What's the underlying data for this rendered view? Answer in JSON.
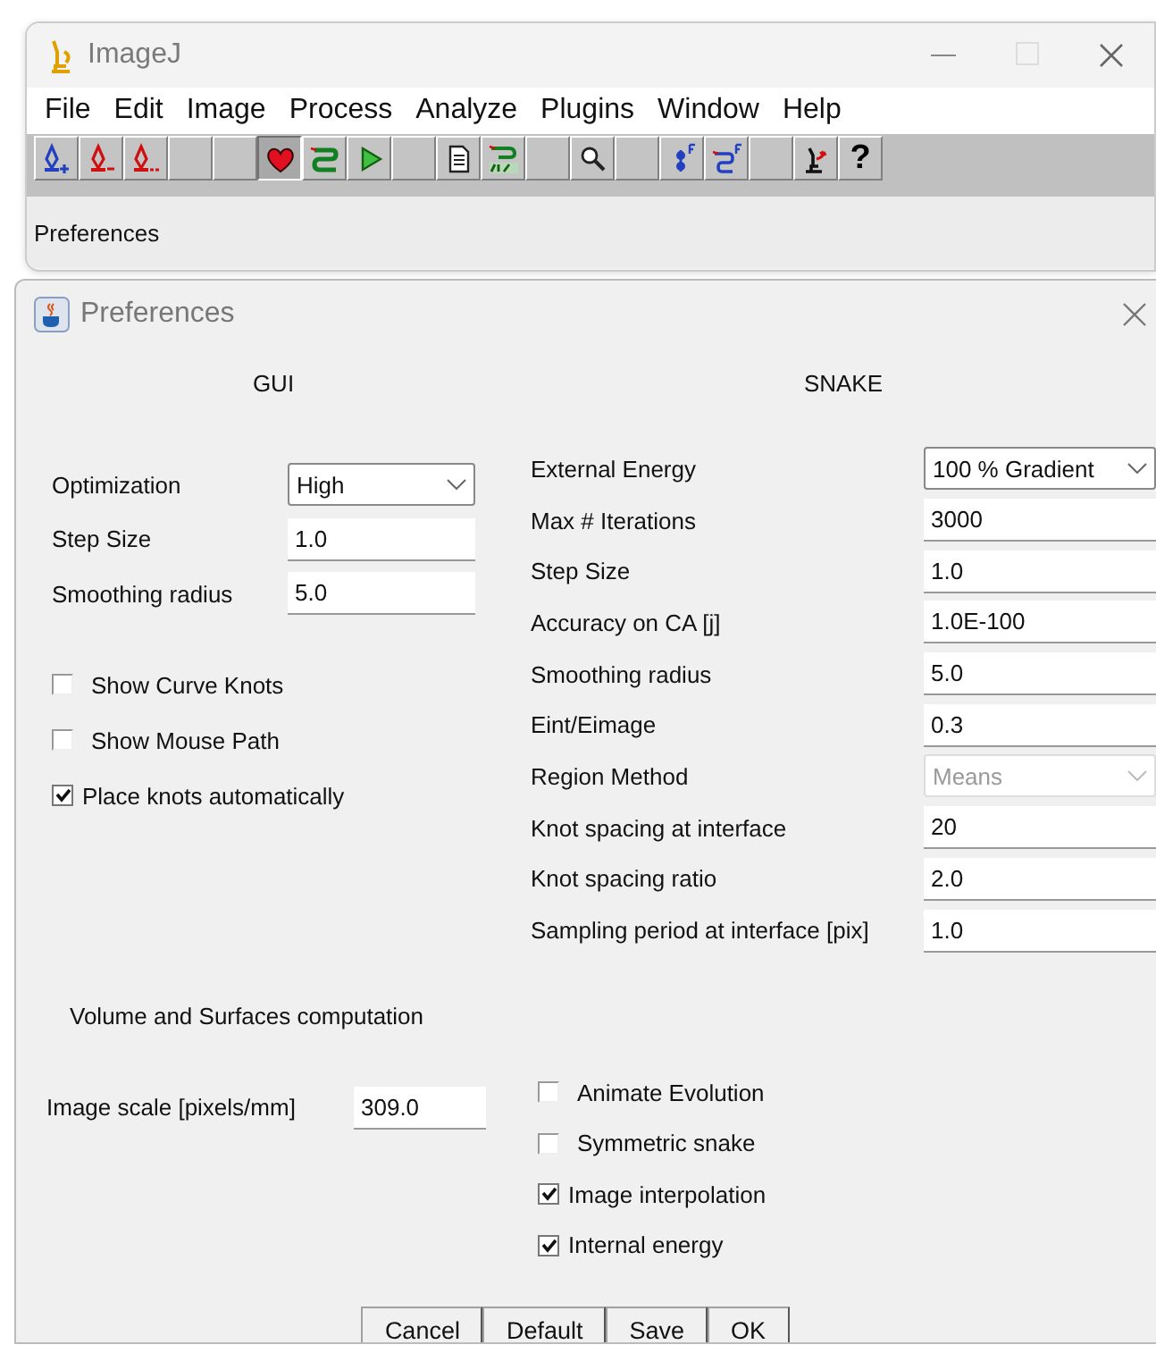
{
  "main_window": {
    "title": "ImageJ",
    "menu": [
      "File",
      "Edit",
      "Image",
      "Process",
      "Analyze",
      "Plugins",
      "Window",
      "Help"
    ],
    "toolbar": [
      {
        "kind": "pen-plus",
        "selected": false
      },
      {
        "kind": "pen-minus",
        "selected": false
      },
      {
        "kind": "pen-minus-all",
        "selected": false
      },
      {
        "kind": "blank",
        "selected": false
      },
      {
        "kind": "blank",
        "selected": false
      },
      {
        "kind": "heart",
        "selected": true
      },
      {
        "kind": "snake",
        "selected": false
      },
      {
        "kind": "play",
        "selected": false
      },
      {
        "kind": "blank",
        "selected": false
      },
      {
        "kind": "document",
        "selected": false
      },
      {
        "kind": "sequence",
        "selected": false
      },
      {
        "kind": "blank",
        "selected": false
      },
      {
        "kind": "magnifier",
        "selected": false
      },
      {
        "kind": "blank",
        "selected": false
      },
      {
        "kind": "knots",
        "selected": false
      },
      {
        "kind": "snake-line",
        "selected": false
      },
      {
        "kind": "blank",
        "selected": false
      },
      {
        "kind": "microscope",
        "selected": false
      },
      {
        "kind": "help",
        "label": "?",
        "selected": false
      }
    ],
    "status": "Preferences"
  },
  "dialog": {
    "title": "Preferences",
    "gui": {
      "heading": "GUI",
      "fields": [
        {
          "kind": "dropdown",
          "label": "Optimization",
          "value": "High",
          "disabled": false
        },
        {
          "kind": "text",
          "label": "Step Size",
          "value": "1.0"
        },
        {
          "kind": "text",
          "label": "Smoothing radius",
          "value": "5.0"
        }
      ],
      "checkboxes": [
        {
          "label": "Show Curve Knots",
          "checked": false
        },
        {
          "label": "Show Mouse Path",
          "checked": false
        },
        {
          "label": "Place knots automatically",
          "checked": true
        }
      ]
    },
    "snake": {
      "heading": "SNAKE",
      "fields": [
        {
          "kind": "dropdown",
          "label": "External Energy",
          "value": "100 % Gradient",
          "disabled": false
        },
        {
          "kind": "text",
          "label": "Max # Iterations",
          "value": "3000"
        },
        {
          "kind": "text",
          "label": "Step Size",
          "value": "1.0"
        },
        {
          "kind": "text",
          "label": "Accuracy on CA [j]",
          "value": "1.0E-100"
        },
        {
          "kind": "text",
          "label": "Smoothing radius",
          "value": "5.0"
        },
        {
          "kind": "text",
          "label": "Eint/Eimage",
          "value": "0.3"
        },
        {
          "kind": "dropdown",
          "label": "Region Method",
          "value": "Means",
          "disabled": true
        },
        {
          "kind": "text",
          "label": "Knot spacing at interface",
          "value": "20"
        },
        {
          "kind": "text",
          "label": "Knot spacing ratio",
          "value": "2.0"
        },
        {
          "kind": "text",
          "label": "Sampling period at interface [pix]",
          "value": "1.0"
        }
      ]
    },
    "volume": {
      "heading": "Volume and Surfaces computation",
      "fields": [
        {
          "kind": "text",
          "label": "Image scale [pixels/mm]",
          "value": "309.0"
        }
      ]
    },
    "options": [
      {
        "label": "Animate Evolution",
        "checked": false
      },
      {
        "label": "Symmetric snake",
        "checked": false
      },
      {
        "label": "Image interpolation",
        "checked": true
      },
      {
        "label": "Internal energy",
        "checked": true
      }
    ],
    "buttons": [
      "Cancel",
      "Default",
      "Save",
      "OK"
    ]
  }
}
